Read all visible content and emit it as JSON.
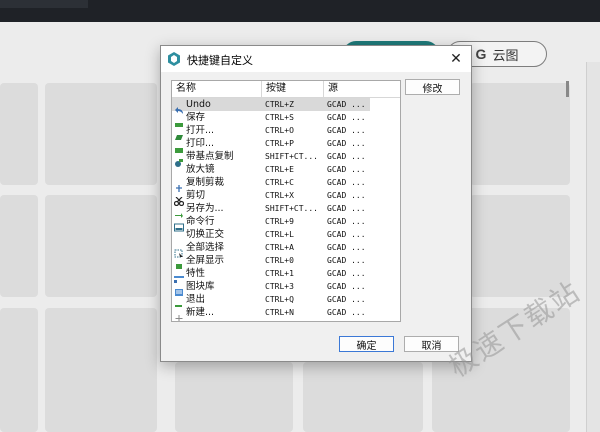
{
  "dialog": {
    "title": "快捷键自定义",
    "close_symbol": "✕",
    "columns": [
      "名称",
      "按键",
      "源"
    ],
    "rows": [
      {
        "icon": "undo-icon",
        "name": "Undo",
        "key": "CTRL+Z",
        "source": "GCAD ...",
        "selected": true
      },
      {
        "icon": "save-icon",
        "name": "保存",
        "key": "CTRL+S",
        "source": "GCAD ..."
      },
      {
        "icon": "open-icon",
        "name": "打开...",
        "key": "CTRL+O",
        "source": "GCAD ..."
      },
      {
        "icon": "print-icon",
        "name": "打印...",
        "key": "CTRL+P",
        "source": "GCAD ..."
      },
      {
        "icon": "copy-basepoint-icon",
        "name": "带基点复制",
        "key": "SHIFT+CT...",
        "source": "GCAD ..."
      },
      {
        "icon": "",
        "name": "放大镜",
        "key": "CTRL+E",
        "source": "GCAD ..."
      },
      {
        "icon": "copy-clip-icon",
        "name": "复制剪裁",
        "key": "CTRL+C",
        "source": "GCAD ..."
      },
      {
        "icon": "cut-icon",
        "name": "剪切",
        "key": "CTRL+X",
        "source": "GCAD ..."
      },
      {
        "icon": "save-as-icon",
        "name": "另存为...",
        "key": "SHIFT+CT...",
        "source": "GCAD ..."
      },
      {
        "icon": "command-line-icon",
        "name": "命令行",
        "key": "CTRL+9",
        "source": "GCAD ..."
      },
      {
        "icon": "",
        "name": "切换正交",
        "key": "CTRL+L",
        "source": "GCAD ..."
      },
      {
        "icon": "select-all-icon",
        "name": "全部选择",
        "key": "CTRL+A",
        "source": "GCAD ..."
      },
      {
        "icon": "fullscreen-icon",
        "name": "全屏显示",
        "key": "CTRL+0",
        "source": "GCAD ..."
      },
      {
        "icon": "properties-icon",
        "name": "特性",
        "key": "CTRL+1",
        "source": "GCAD ..."
      },
      {
        "icon": "block-library-icon",
        "name": "图块库",
        "key": "CTRL+3",
        "source": "GCAD ..."
      },
      {
        "icon": "exit-icon",
        "name": "退出",
        "key": "CTRL+Q",
        "source": "GCAD ..."
      },
      {
        "icon": "new-icon",
        "name": "新建...",
        "key": "CTRL+N",
        "source": "GCAD ..."
      }
    ],
    "edit_label": "修改",
    "ok_label": "确定",
    "cancel_label": "取消"
  },
  "background": {
    "cloud_button_letter": "G",
    "cloud_button_label": "云图"
  },
  "watermark": "极速下载站",
  "colors": {
    "accent_teal": "#1f7a7a",
    "selection": "#d9d9d9",
    "default_button_border": "#3b78d6"
  }
}
